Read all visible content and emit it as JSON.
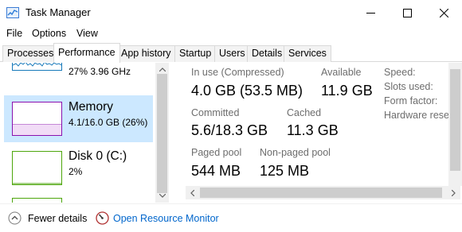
{
  "window": {
    "title": "Task Manager",
    "icons": {
      "app": "task-manager-icon",
      "minimize": "minimize-icon",
      "maximize": "maximize-icon",
      "close": "close-icon"
    }
  },
  "menu": {
    "file": "File",
    "options": "Options",
    "view": "View"
  },
  "tabs": {
    "processes": "Processes",
    "performance": "Performance",
    "app_history": "App history",
    "startup": "Startup",
    "users": "Users",
    "details": "Details",
    "services": "Services",
    "active": "Performance"
  },
  "sidebar": {
    "cpu": {
      "sub": "27%  3.96 GHz"
    },
    "memory": {
      "name": "Memory",
      "sub": "4.1/16.0 GB (26%)",
      "color": "#8b12ae"
    },
    "disk": {
      "name": "Disk 0 (C:)",
      "sub": "2%",
      "color": "#4da60c"
    }
  },
  "memory_details": {
    "in_use_label": "In use (Compressed)",
    "in_use_value": "4.0 GB (53.5 MB)",
    "available_label": "Available",
    "available_value": "11.9 GB",
    "committed_label": "Committed",
    "committed_value": "5.6/18.3 GB",
    "cached_label": "Cached",
    "cached_value": "11.3 GB",
    "paged_label": "Paged pool",
    "paged_value": "544 MB",
    "nonpaged_label": "Non-paged pool",
    "nonpaged_value": "125 MB",
    "speed_label": "Speed:",
    "slots_label": "Slots used:",
    "form_label": "Form factor:",
    "hw_label": "Hardware reser"
  },
  "footer": {
    "fewer_details": "Fewer details",
    "open_monitor": "Open Resource Monitor",
    "icons": {
      "fewer": "chevron-up-circle-icon",
      "monitor": "resource-monitor-icon"
    }
  },
  "colors": {
    "selection": "#cce8ff",
    "link": "#0066cc",
    "label_gray": "#6d6d6d"
  }
}
